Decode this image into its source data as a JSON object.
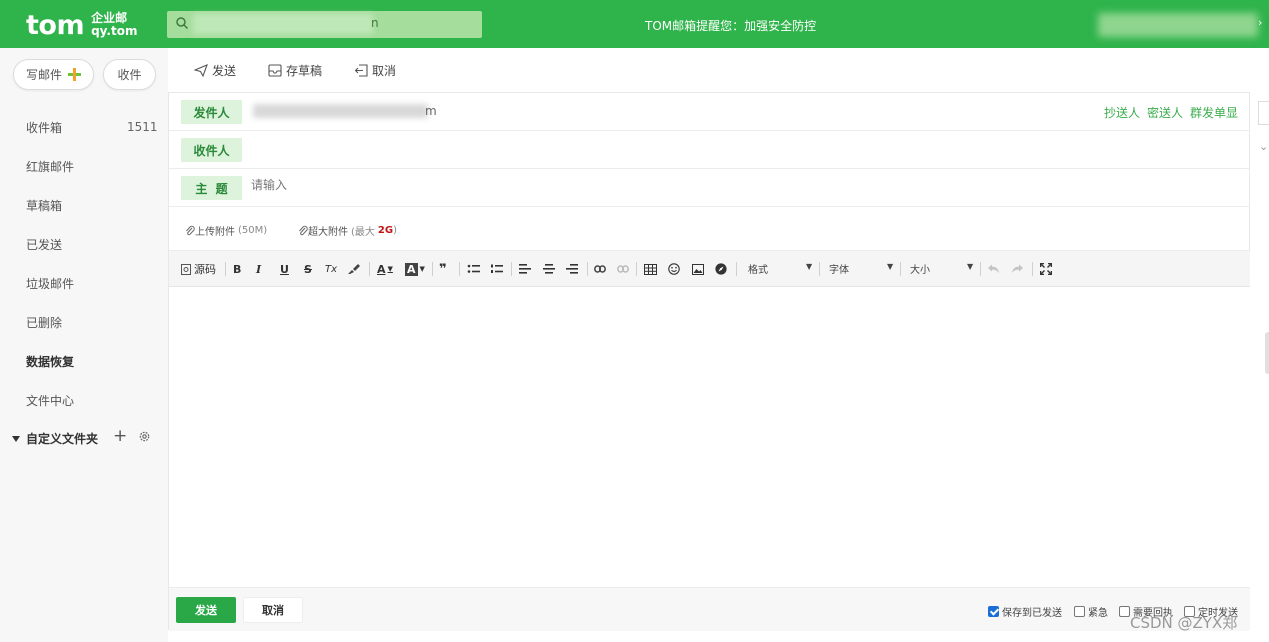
{
  "brand": {
    "logo_word": "tom",
    "logo_line1": "企业邮",
    "logo_line2": "qy.tom"
  },
  "search": {
    "visible_suffix": "n"
  },
  "notice": "TOM邮箱提醒您：加强安全防控",
  "sidebar": {
    "compose_label": "写邮件",
    "receive_label": "收件",
    "folders": [
      {
        "label": "收件箱",
        "count": "1511"
      },
      {
        "label": "红旗邮件"
      },
      {
        "label": "草稿箱"
      },
      {
        "label": "已发送"
      },
      {
        "label": "垃圾邮件"
      },
      {
        "label": "已删除"
      },
      {
        "label": "数据恢复"
      },
      {
        "label": "文件中心"
      }
    ],
    "custom_folders_label": "自定义文件夹"
  },
  "toolbar": {
    "send": "发送",
    "save_draft": "存草稿",
    "cancel": "取消"
  },
  "compose": {
    "sender_label": "发件人",
    "sender_visible_suffix": "m",
    "recipient_label": "收件人",
    "subject_label": "主  题",
    "subject_placeholder": "请输入",
    "cc": "抄送人",
    "bcc": "密送人",
    "separate": "群发单显",
    "attach_label": "上传附件",
    "attach_limit": "(50M)",
    "big_attach_label": "超大附件",
    "big_attach_prefix": "(最大",
    "big_attach_size": "2G",
    "big_attach_suffix": ")"
  },
  "editor": {
    "source": "源码",
    "bold": "B",
    "italic": "I",
    "underline": "U",
    "strike": "S",
    "clear_format": "Tx",
    "font_color": "A",
    "bg_color": "A",
    "quote": "❞",
    "format_label": "格式",
    "font_label": "字体",
    "size_label": "大小"
  },
  "footer": {
    "send": "发送",
    "cancel": "取消",
    "options": [
      {
        "label": "保存到已发送",
        "checked": true
      },
      {
        "label": "紧急",
        "checked": false
      },
      {
        "label": "需要回执",
        "checked": false
      },
      {
        "label": "定时发送",
        "checked": false
      }
    ]
  },
  "watermark": "CSDN @ZYX郑",
  "colors": {
    "brand_green": "#2fb34b",
    "label_bg": "#def3dc",
    "link_green": "#3aac4b",
    "send_green": "#2aa848"
  }
}
